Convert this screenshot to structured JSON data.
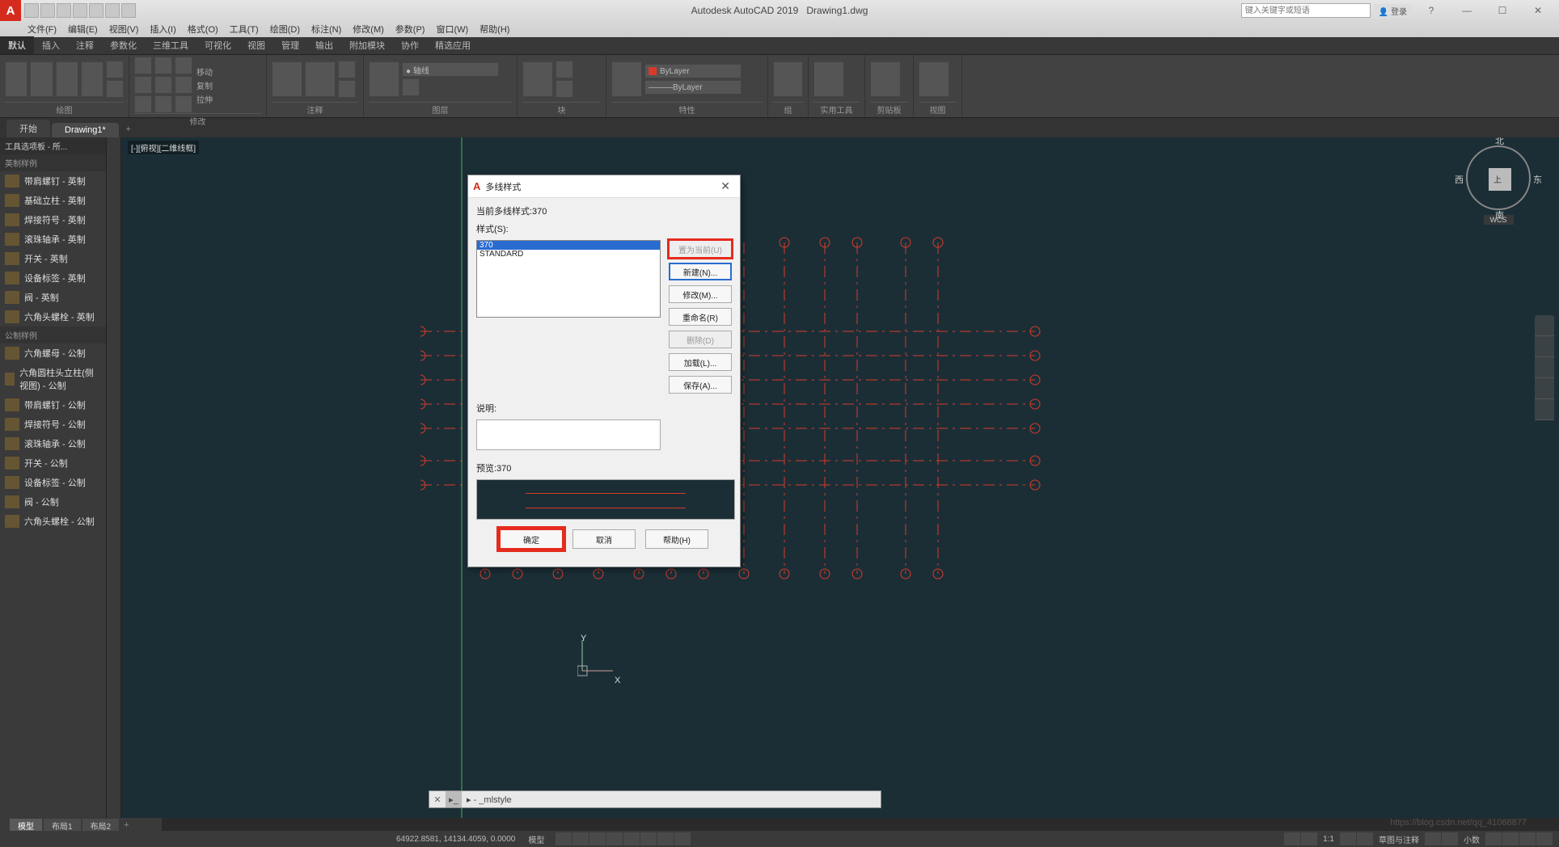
{
  "titlebar": {
    "app_title": "Autodesk AutoCAD 2019",
    "doc_title": "Drawing1.dwg",
    "search_placeholder": "键入关键字或短语",
    "login": "登录"
  },
  "menubar": [
    "文件(F)",
    "编辑(E)",
    "视图(V)",
    "插入(I)",
    "格式(O)",
    "工具(T)",
    "绘图(D)",
    "标注(N)",
    "修改(M)",
    "参数(P)",
    "窗口(W)",
    "帮助(H)"
  ],
  "ribbon_tabs": [
    "默认",
    "插入",
    "注释",
    "参数化",
    "三维工具",
    "可视化",
    "视图",
    "管理",
    "输出",
    "附加模块",
    "协作",
    "精选应用"
  ],
  "ribbon_panels": [
    "绘图",
    "修改",
    "注释",
    "图层",
    "块",
    "特性",
    "组",
    "实用工具",
    "剪贴板",
    "视图"
  ],
  "layer_props": {
    "bylayer1": "ByLayer",
    "bylayer2": "ByLayer"
  },
  "filetabs": {
    "start": "开始",
    "active": "Drawing1*"
  },
  "palette": {
    "title": "工具选项板 - 所...",
    "section1": "英制样例",
    "items1": [
      "带肩螺钉 - 英制",
      "基础立柱 - 英制",
      "焊接符号 - 英制",
      "滚珠轴承 - 英制",
      "开关 - 英制",
      "设备标签 - 英制",
      "阀 - 英制",
      "六角头螺栓 - 英制"
    ],
    "section2": "公制样例",
    "items2": [
      "六角螺母 - 公制",
      "六角圆柱头立柱(侧视图) - 公制",
      "带肩螺钉 - 公制",
      "焊接符号 - 公制",
      "滚珠轴承 - 公制",
      "开关 - 公制",
      "设备标签 - 公制",
      "阀 - 公制",
      "六角头螺栓 - 公制"
    ]
  },
  "viewport": {
    "label": "[-][俯视][二维线框]",
    "compass": {
      "n": "北",
      "s": "南",
      "e": "东",
      "w": "西",
      "top": "上"
    },
    "wcs": "WCS",
    "ucs": {
      "x": "X",
      "y": "Y"
    }
  },
  "cmdline": {
    "text": "▸ - _mlstyle"
  },
  "dialog": {
    "title": "多线样式",
    "current_label": "当前多线样式:370",
    "style_label": "样式(S):",
    "styles": [
      "370",
      "STANDARD"
    ],
    "desc_label": "说明:",
    "preview_label": "预览:370",
    "buttons": {
      "set_current": "置为当前(U)",
      "new": "新建(N)...",
      "modify": "修改(M)...",
      "rename": "重命名(R)",
      "delete": "删除(D)",
      "load": "加载(L)...",
      "save": "保存(A)..."
    },
    "ok": "确定",
    "cancel": "取消",
    "help": "帮助(H)"
  },
  "bottom_tabs": [
    "模型",
    "布局1",
    "布局2"
  ],
  "statusbar": {
    "coords": "64922.8581, 14134.4059, 0.0000",
    "model": "模型",
    "scale": "1:1",
    "annot": "草图与注释",
    "dec": "小数"
  },
  "watermark": "https://blog.csdn.net/qq_41068877"
}
